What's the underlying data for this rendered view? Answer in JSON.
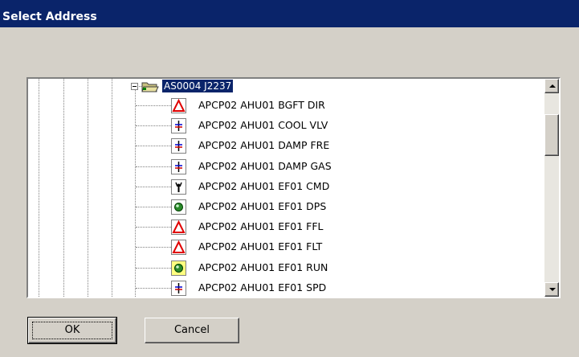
{
  "window": {
    "title": "Select Address"
  },
  "tree": {
    "root": {
      "label": "AS0004 J2237"
    },
    "items": [
      {
        "label": "APCP02 AHU01 BGFT DIR",
        "icon": "alarm-triangle-icon"
      },
      {
        "label": "APCP02 AHU01 COOL VLV",
        "icon": "analog-output-icon"
      },
      {
        "label": "APCP02 AHU01 DAMP FRE",
        "icon": "analog-output-icon"
      },
      {
        "label": "APCP02 AHU01 DAMP GAS",
        "icon": "analog-output-icon"
      },
      {
        "label": "APCP02 AHU01 EF01 CMD",
        "icon": "digital-output-icon"
      },
      {
        "label": "APCP02 AHU01 EF01 DPS",
        "icon": "digital-input-icon"
      },
      {
        "label": "APCP02 AHU01 EF01 FFL",
        "icon": "alarm-triangle-icon"
      },
      {
        "label": "APCP02 AHU01 EF01 FLT",
        "icon": "alarm-triangle-icon"
      },
      {
        "label": "APCP02 AHU01 EF01 RUN",
        "icon": "digital-input-icon"
      },
      {
        "label": "APCP02 AHU01 EF01 SPD",
        "icon": "analog-output-icon"
      }
    ]
  },
  "buttons": {
    "ok": "OK",
    "cancel": "Cancel"
  }
}
